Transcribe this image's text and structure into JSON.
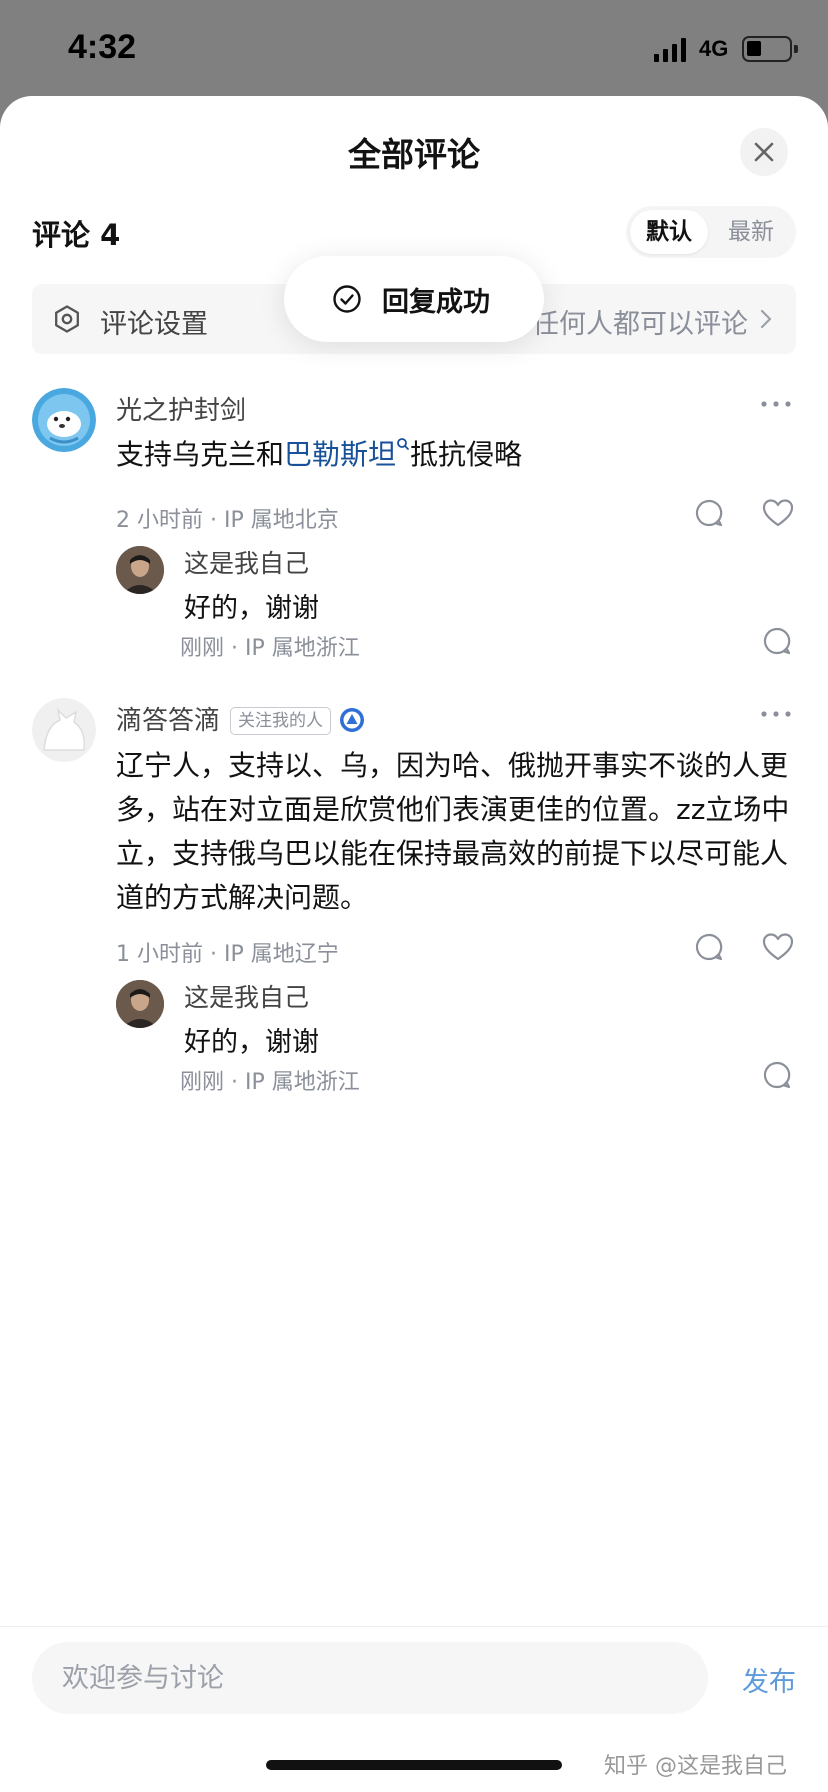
{
  "status_bar": {
    "time": "4:32",
    "network": "4G"
  },
  "header": {
    "title": "全部评论",
    "close_icon": "close-icon"
  },
  "toolbar": {
    "count_label": "评论 4",
    "sort_default": "默认",
    "sort_latest": "最新"
  },
  "settings": {
    "label": "评论设置",
    "value": "任何人都可以评论"
  },
  "toast": {
    "text": "回复成功"
  },
  "comments": [
    {
      "author": "光之护封剑",
      "text_before": "支持乌克兰和",
      "keyword": "巴勒斯坦",
      "text_after": "抵抗侵略",
      "meta": "2 小时前 · IP 属地北京",
      "reply": {
        "author": "这是我自己",
        "text": "好的，谢谢",
        "meta": "刚刚 · IP 属地浙江"
      }
    },
    {
      "author": "滴答答滴",
      "badge": "关注我的人",
      "text": "辽宁人，支持以、乌，因为哈、俄抛开事实不谈的人更多，站在对立面是欣赏他们表演更佳的位置。zz立场中立，支持俄乌巴以能在保持最高效的前提下以尽可能人道的方式解决问题。",
      "meta": "1 小时前 · IP 属地辽宁",
      "reply": {
        "author": "这是我自己",
        "text": "好的，谢谢",
        "meta": "刚刚 · IP 属地浙江"
      }
    }
  ],
  "composer": {
    "placeholder": "欢迎参与讨论",
    "publish_label": "发布"
  },
  "watermark": "知乎 @这是我自己",
  "colors": {
    "link": "#175199",
    "publish": "#5f9bdb",
    "meta": "#8a8f99"
  }
}
